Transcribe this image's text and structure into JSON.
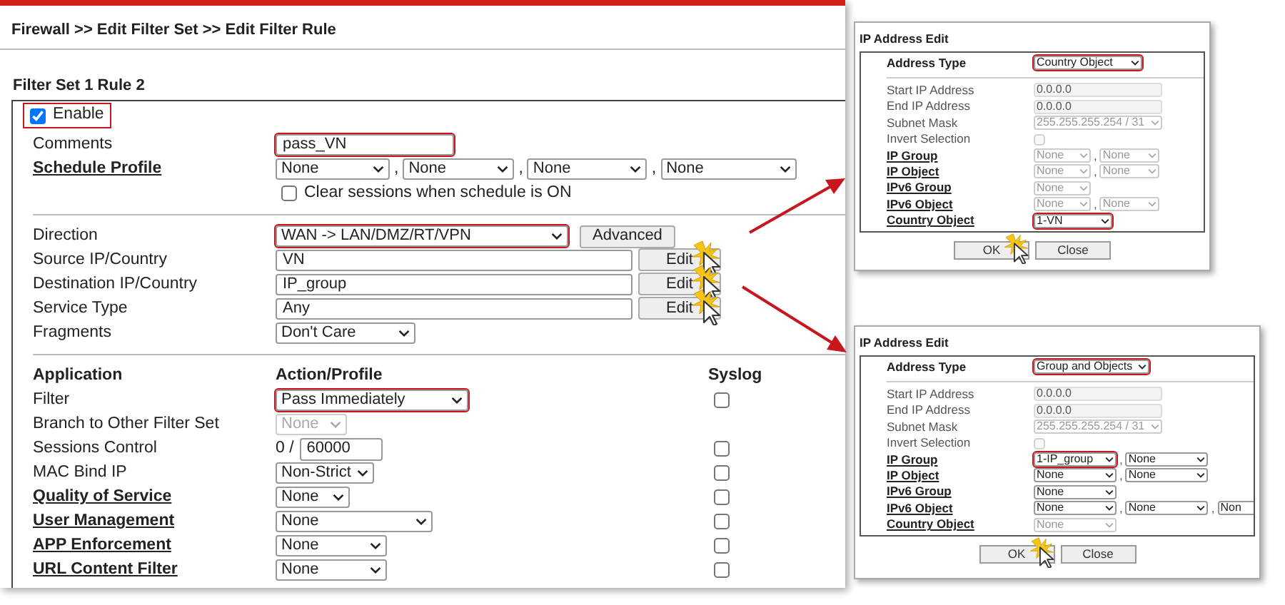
{
  "breadcrumb": "Firewall >> Edit Filter Set >> Edit Filter Rule",
  "rule_title": "Filter Set 1 Rule 2",
  "enable": {
    "label": "Enable",
    "checked": true,
    "highlighted": true
  },
  "settings": [
    {
      "kind": "text",
      "label": "Comments",
      "value": "pass_VN",
      "highlighted": true
    },
    {
      "kind": "schedule",
      "label": "Schedule Profile",
      "link": true,
      "selects": [
        {
          "value": "None"
        },
        {
          "prefix": ",",
          "value": "None"
        },
        {
          "prefix": ",",
          "value": "None"
        },
        {
          "prefix": ",",
          "value": "None"
        }
      ],
      "option": {
        "label": "Clear sessions when schedule is ON",
        "checked": false
      }
    },
    {
      "kind": "divider"
    },
    {
      "kind": "select_button",
      "label": "Direction",
      "select": {
        "value": "WAN -> LAN/DMZ/RT/VPN",
        "highlighted": true
      },
      "button": "Advanced"
    },
    {
      "kind": "text_button",
      "label": "Source IP/Country",
      "value": "VN",
      "button": "Edit",
      "cursor": true
    },
    {
      "kind": "text_button",
      "label": "Destination IP/Country",
      "value": "IP_group",
      "button": "Edit",
      "cursor": true
    },
    {
      "kind": "text_button",
      "label": "Service Type",
      "value": "Any",
      "button": "Edit",
      "cursor": true
    },
    {
      "kind": "select",
      "label": "Fragments",
      "select": {
        "value": "Don't Care"
      }
    }
  ],
  "app_columns": [
    "Application",
    "Action/Profile",
    "Syslog"
  ],
  "app_rows": [
    {
      "kind": "select",
      "label": "Filter",
      "select": {
        "value": "Pass Immediately",
        "highlighted": true
      },
      "syslog": false
    },
    {
      "kind": "select",
      "label": "Branch to Other Filter Set",
      "select": {
        "value": "None",
        "disabled": true
      }
    },
    {
      "kind": "number",
      "label": "Sessions Control",
      "prefix": "0 /",
      "value": "60000",
      "syslog": false
    },
    {
      "kind": "select",
      "label": "MAC Bind IP",
      "select": {
        "value": "Non-Strict"
      },
      "syslog": false
    },
    {
      "kind": "select",
      "label": "Quality of Service",
      "link": true,
      "select": {
        "value": "None"
      },
      "syslog": false
    },
    {
      "kind": "select",
      "label": "User Management",
      "link": true,
      "select": {
        "value": "None"
      },
      "syslog": false
    },
    {
      "kind": "select",
      "label": "APP Enforcement",
      "link": true,
      "select": {
        "value": "None"
      },
      "syslog": false
    },
    {
      "kind": "select",
      "label": "URL Content Filter",
      "link": true,
      "select": {
        "value": "None"
      },
      "syslog": false
    }
  ],
  "popups": [
    {
      "title": "IP Address Edit",
      "address_type": {
        "label": "Address Type",
        "select": {
          "value": "Country Object",
          "highlighted": true
        }
      },
      "fields": [
        {
          "kind": "text",
          "label": "Start IP Address",
          "value": "0.0.0.0",
          "disabled": true
        },
        {
          "kind": "text",
          "label": "End IP Address",
          "value": "0.0.0.0",
          "disabled": true
        },
        {
          "kind": "select",
          "label": "Subnet Mask",
          "selects": [
            {
              "value": "255.255.255.254 / 31",
              "disabled": true
            }
          ]
        },
        {
          "kind": "checkbox",
          "label": "Invert Selection",
          "checked": false,
          "disabled": true
        },
        {
          "kind": "select",
          "label": "IP Group",
          "link": true,
          "selects": [
            {
              "value": "None",
              "disabled": true
            },
            {
              "prefix": ",",
              "value": "None",
              "disabled": true
            }
          ]
        },
        {
          "kind": "select",
          "label": "IP Object",
          "link": true,
          "selects": [
            {
              "value": "None",
              "disabled": true
            },
            {
              "prefix": ",",
              "value": "None",
              "disabled": true
            }
          ]
        },
        {
          "kind": "select",
          "label": "IPv6 Group",
          "link": true,
          "selects": [
            {
              "value": "None",
              "disabled": true
            }
          ]
        },
        {
          "kind": "select",
          "label": "IPv6 Object",
          "link": true,
          "selects": [
            {
              "value": "None",
              "disabled": true
            },
            {
              "prefix": ",",
              "value": "None",
              "disabled": true
            }
          ]
        },
        {
          "kind": "select",
          "label": "Country Object",
          "link": true,
          "selects": [
            {
              "value": "1-VN",
              "highlighted": true
            }
          ]
        }
      ],
      "buttons": [
        "OK",
        "Close"
      ],
      "cursor": true
    },
    {
      "title": "IP Address Edit",
      "address_type": {
        "label": "Address Type",
        "select": {
          "value": "Group and Objects",
          "highlighted": true
        }
      },
      "fields": [
        {
          "kind": "text",
          "label": "Start IP Address",
          "value": "0.0.0.0",
          "disabled": true
        },
        {
          "kind": "text",
          "label": "End IP Address",
          "value": "0.0.0.0",
          "disabled": true
        },
        {
          "kind": "select",
          "label": "Subnet Mask",
          "selects": [
            {
              "value": "255.255.255.254 / 31",
              "disabled": true
            }
          ]
        },
        {
          "kind": "checkbox",
          "label": "Invert Selection",
          "checked": false,
          "disabled": true
        },
        {
          "kind": "select",
          "label": "IP Group",
          "link": true,
          "selects": [
            {
              "value": "1-IP_group",
              "highlighted": true
            },
            {
              "prefix": ",",
              "value": "None"
            }
          ]
        },
        {
          "kind": "select",
          "label": "IP Object",
          "link": true,
          "selects": [
            {
              "value": "None"
            },
            {
              "prefix": ",",
              "value": "None"
            }
          ]
        },
        {
          "kind": "select",
          "label": "IPv6 Group",
          "link": true,
          "selects": [
            {
              "value": "None"
            }
          ]
        },
        {
          "kind": "select",
          "label": "IPv6 Object",
          "link": true,
          "selects": [
            {
              "value": "None"
            },
            {
              "prefix": ",",
              "value": "None"
            },
            {
              "prefix": ",",
              "value": "Non"
            }
          ]
        },
        {
          "kind": "select",
          "label": "Country Object",
          "link": true,
          "selects": [
            {
              "value": "None",
              "disabled": true
            }
          ]
        }
      ],
      "buttons": [
        "OK",
        "Close"
      ],
      "cursor": true
    }
  ]
}
